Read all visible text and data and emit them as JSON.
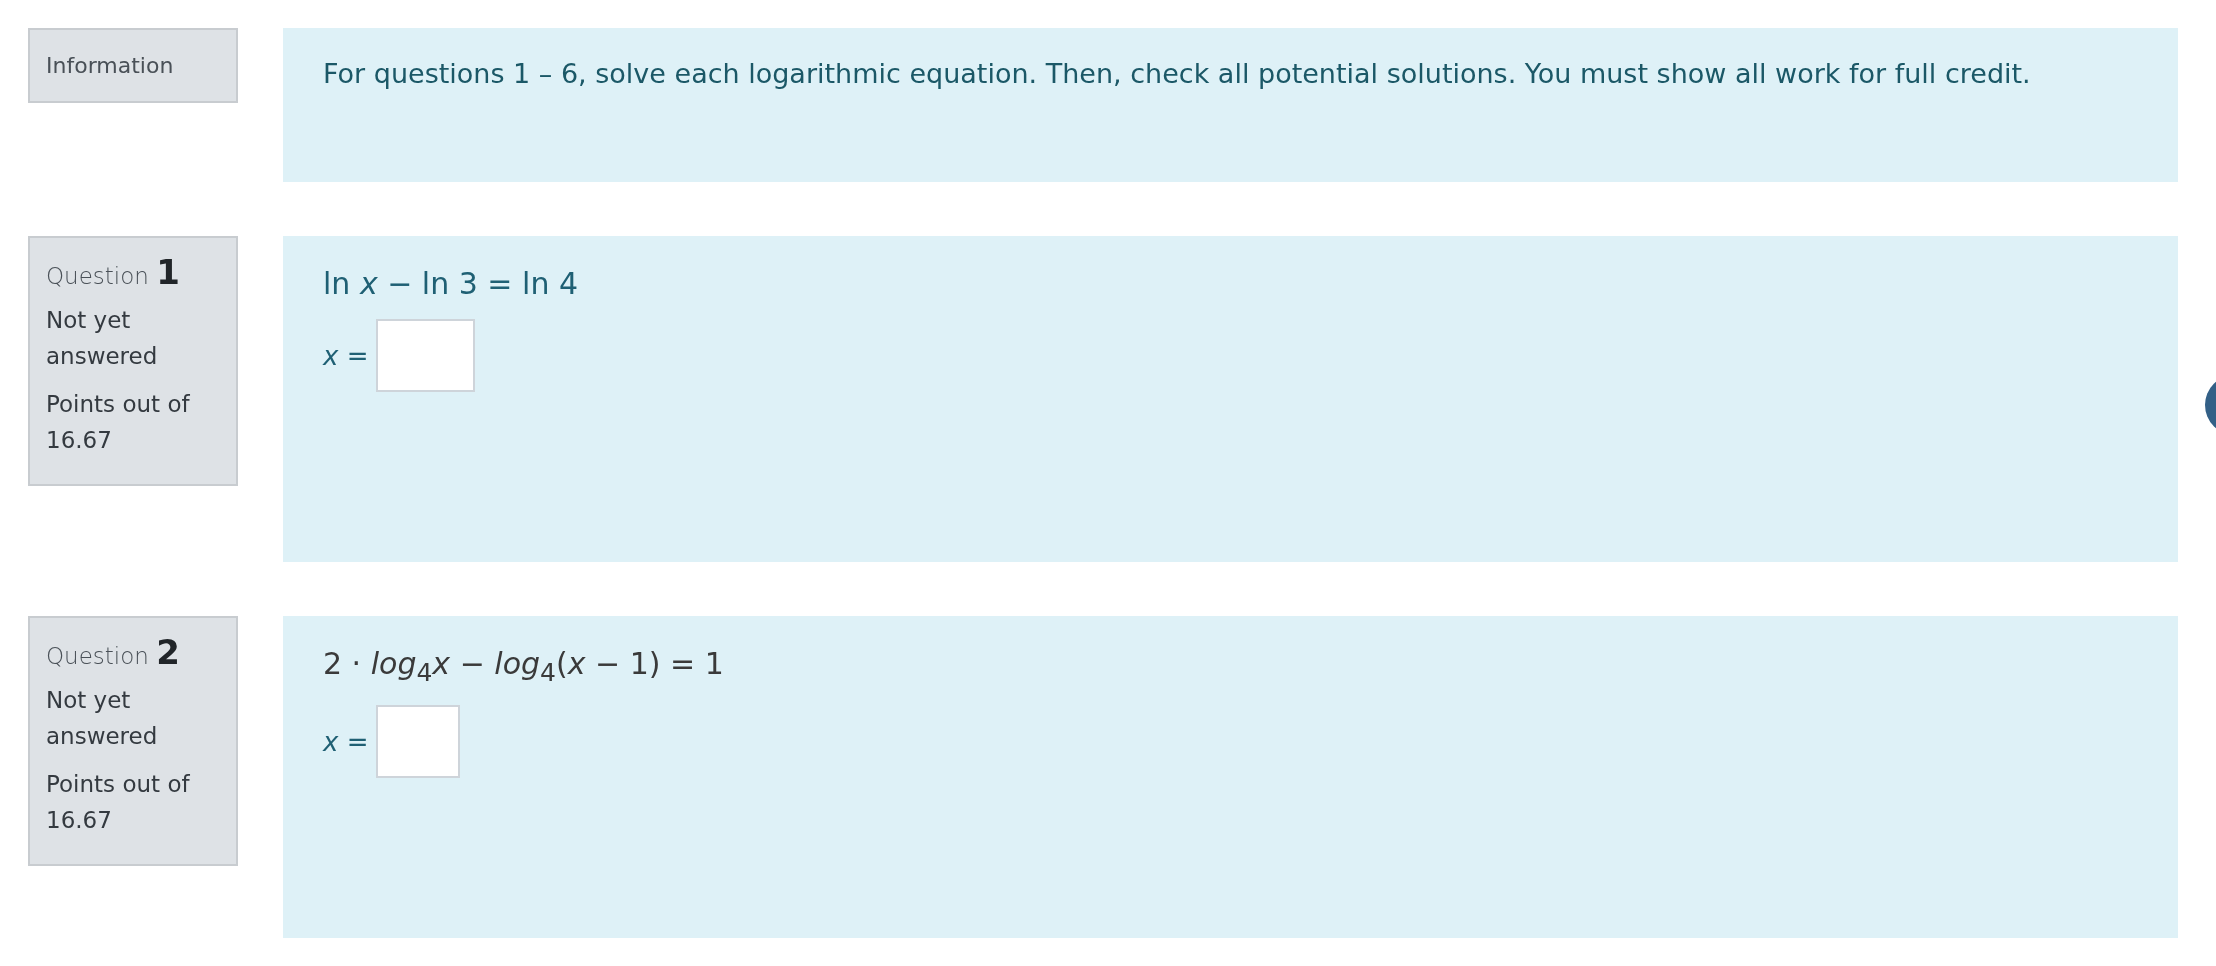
{
  "information": {
    "label": "Information",
    "text": "For questions 1 – 6, solve each logarithmic equation. Then, check all potential solutions. You must show all work for full credit."
  },
  "questions": [
    {
      "label": "Question",
      "number": "1",
      "status": "Not yet answered",
      "points_label": "Points out of",
      "points": "16.67",
      "kind": "text",
      "equation": "ln *x* − ln 3 = ln 4",
      "answer_label": "*x* ="
    },
    {
      "label": "Question",
      "number": "2",
      "status": "Not yet answered",
      "points_label": "Points out of",
      "points": "16.67",
      "kind": "math",
      "equation": "2 · *log*$_{4}$*x* − *log*$_{4}$(*x* − 1) = 1",
      "answer_label": "*x* ="
    }
  ]
}
